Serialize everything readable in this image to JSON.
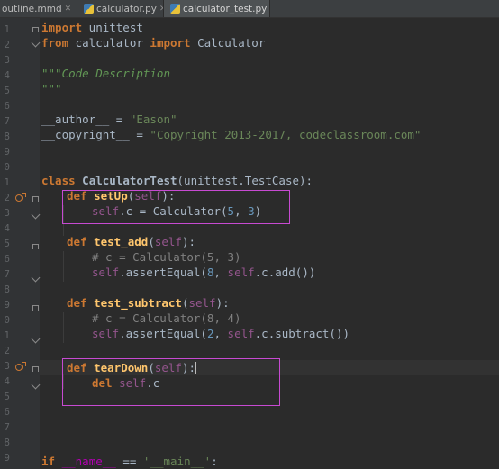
{
  "tabs": [
    {
      "label": "outline.mmd",
      "icon": "file-icon",
      "active": false
    },
    {
      "label": "calculator.py",
      "icon": "python-file-icon",
      "active": false
    },
    {
      "label": "calculator_test.py",
      "icon": "python-file-icon",
      "active": true
    }
  ],
  "gutter": {
    "line_numbers": [
      "1",
      "2",
      "3",
      "4",
      "5",
      "6",
      "7",
      "8",
      "9",
      "0",
      "1",
      "2",
      "3",
      "4",
      "5",
      "6",
      "7",
      "8",
      "9",
      "0",
      "1",
      "2",
      "3",
      "4",
      "5",
      "6",
      "7",
      "8",
      "9"
    ]
  },
  "code": {
    "l1": {
      "kw": "import",
      "rest": " unittest"
    },
    "l2": {
      "kw1": "from",
      "mid": " calculator ",
      "kw2": "import",
      "rest": " Calculator"
    },
    "l4": "\"\"\"Code Description",
    "l5": "\"\"\"",
    "l7": {
      "name": "__author__",
      "op": " = ",
      "val": "\"Eason\""
    },
    "l8": {
      "name": "__copyright__",
      "op": " = ",
      "val": "\"Copyright 2013-2017, codeclassroom.com\""
    },
    "l11": {
      "kw": "class",
      "name": "CalculatorTest",
      "base": "(unittest.TestCase):"
    },
    "l12": {
      "kw": "def",
      "fn": "setUp",
      "p1": "(",
      "self": "self",
      "p2": "):"
    },
    "l13": {
      "self": "self",
      "rest1": ".c = Calculator(",
      "n1": "5",
      "sep": ", ",
      "n2": "3",
      "rest2": ")"
    },
    "l15": {
      "kw": "def",
      "fn": "test_add",
      "p1": "(",
      "self": "self",
      "p2": "):"
    },
    "l16": "# c = Calculator(5, 3)",
    "l17": {
      "self": "self",
      "m1": ".assertEqual(",
      "n": "8",
      "m2": ", ",
      "self2": "self",
      "m3": ".c.add())"
    },
    "l19": {
      "kw": "def",
      "fn": "test_subtract",
      "p1": "(",
      "self": "self",
      "p2": "):"
    },
    "l20": "# c = Calculator(8, 4)",
    "l21": {
      "self": "self",
      "m1": ".assertEqual(",
      "n": "2",
      "m2": ", ",
      "self2": "self",
      "m3": ".c.subtract())"
    },
    "l23": {
      "kw": "def",
      "fn": "tearDown",
      "p1": "(",
      "self": "self",
      "p2": "):"
    },
    "l24": {
      "kw": "del",
      "sp": " ",
      "self": "self",
      "rest": ".c"
    },
    "l29": {
      "kw": "if",
      "name": "__name__",
      "op": " == ",
      "val": "'__main__'",
      "colon": ":"
    }
  },
  "colors": {
    "background": "#2b2b2b",
    "keyword": "#cc7832",
    "string": "#6a8759",
    "number": "#6897bb",
    "self": "#94558d",
    "function": "#ffc66d",
    "comment": "#808080",
    "highlight_box": "#c74ad2"
  }
}
